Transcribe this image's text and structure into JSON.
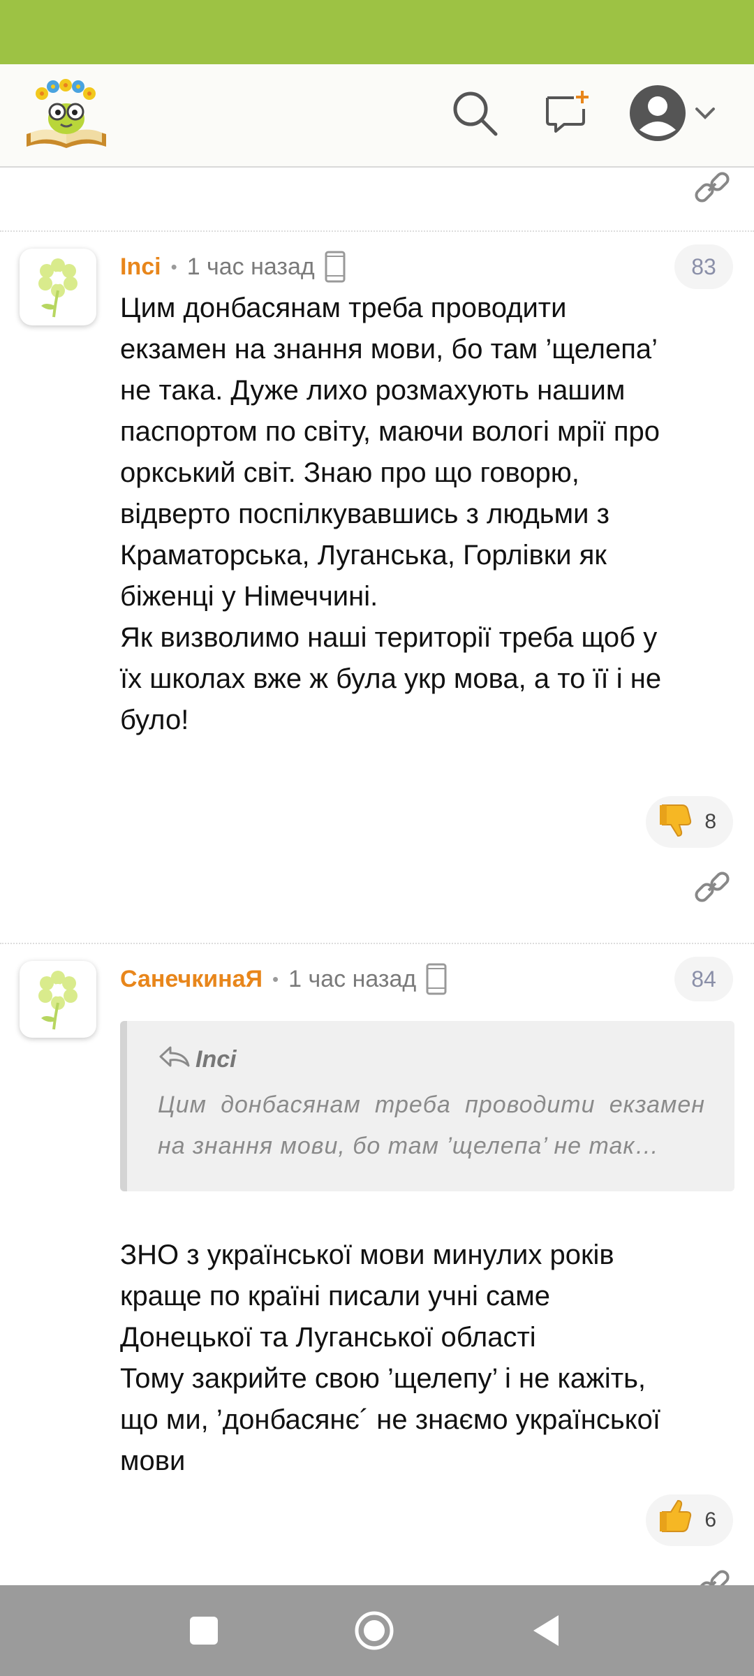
{
  "colors": {
    "status_bar": "#9dc244",
    "author": "#e8861b",
    "nav_bar": "#9b9b9b"
  },
  "header": {
    "logo_icon": "bookworm-logo-icon",
    "search_icon": "search-icon",
    "new_post_icon": "chat-plus-icon",
    "profile_icon": "user-avatar-icon"
  },
  "comments": [
    {
      "author": "Inci",
      "time": "1 час назад",
      "number": "83",
      "text": "Цим донбасянам треба проводити\nекзамен на знання мови, бо там ’щелепа’\nне така. Дуже лихо розмахують нашим\nпаспортом по світу, маючи вологі мрії про\nоркський світ. Знаю про що говорю,\nвідверто поспілкувавшись з людьми з\nКраматорська, Луганська, Горлівки як\nбіженці у Німеччині.\nЯк визволимо наші території треба щоб у\nїх школах вже ж була укр мова, а то її і не\nбуло!",
      "reaction": {
        "icon": "thumbs-down-icon",
        "count": "8"
      }
    },
    {
      "author": "СанечкинаЯ",
      "time": "1 час назад",
      "number": "84",
      "quote": {
        "author": "Inci",
        "text": "Цим донбасянам треба проводити екзамен на знання мови, бо там ’щелепа’ не так…"
      },
      "text": "ЗНО з української мови минулих років\nкраще по країні писали учні саме\nДонецької та Луганської області\nТому закрийте свою ’щелепу’ і не кажіть,\nщо ми, ’донбасянє´ не знаємо української\nмови",
      "reaction": {
        "icon": "thumbs-up-icon",
        "count": "6"
      }
    }
  ]
}
